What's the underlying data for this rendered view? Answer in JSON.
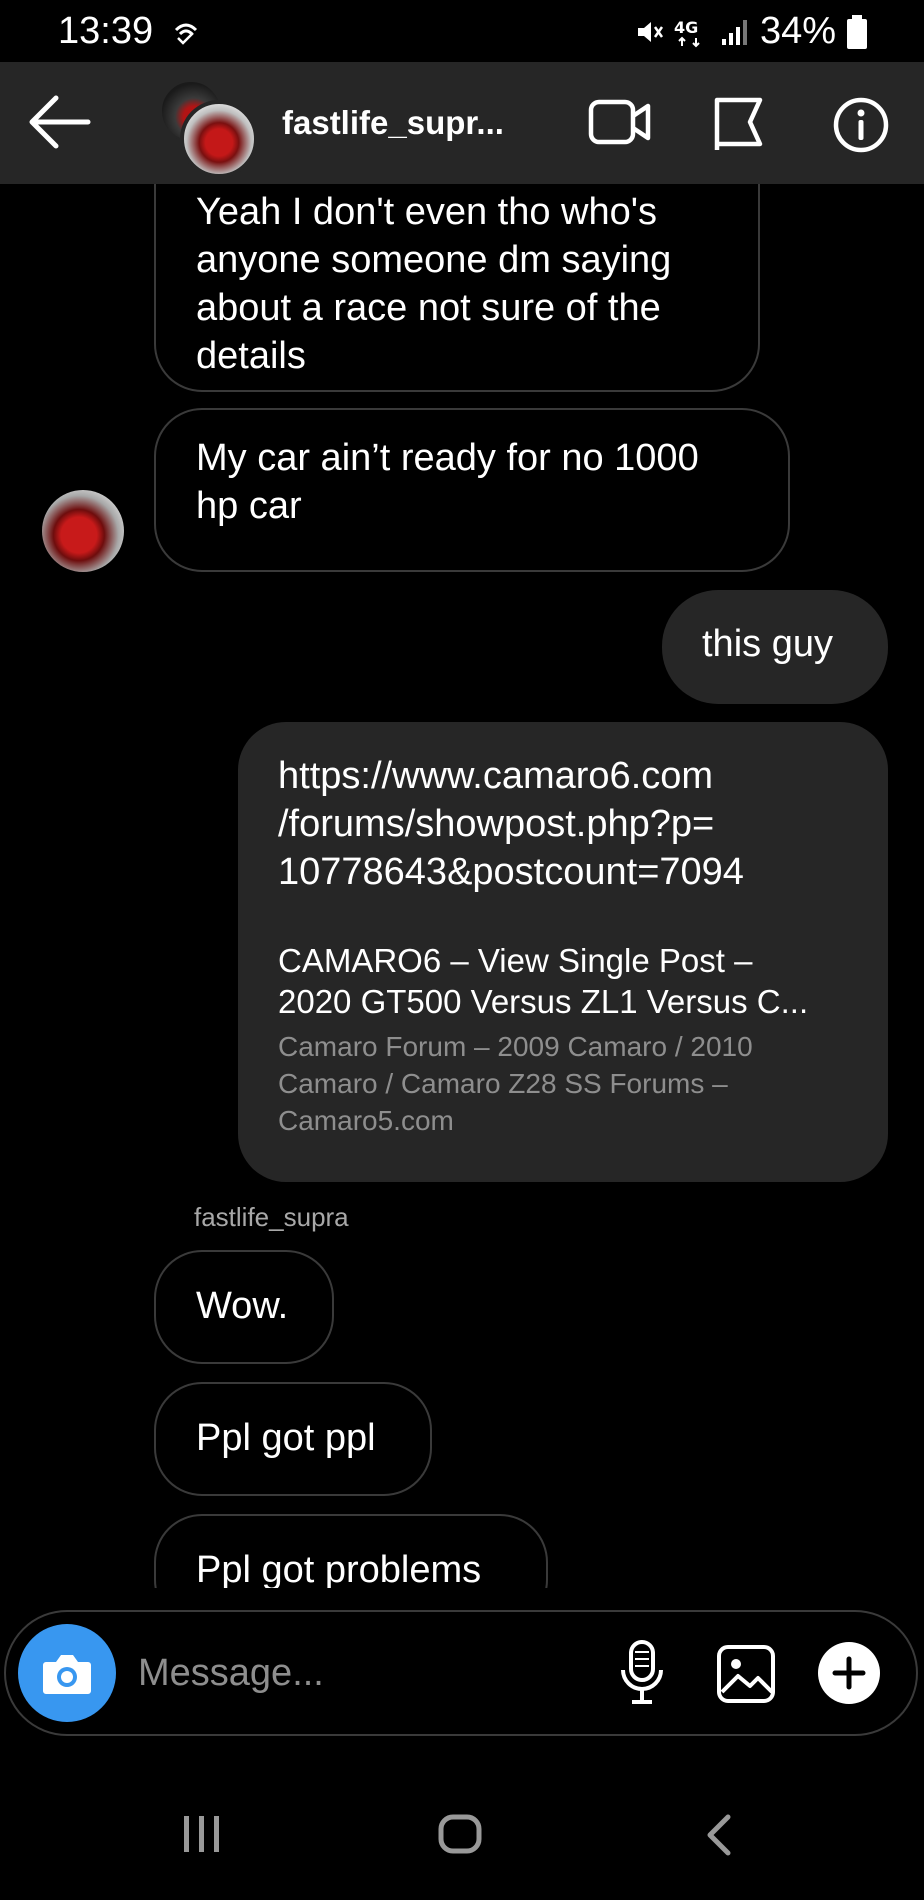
{
  "status_bar": {
    "time": "13:39",
    "battery": "34%"
  },
  "header": {
    "username": "fastlife_supr..."
  },
  "messages": [
    {
      "direction": "incoming",
      "lines": [
        "Yeah I don't even tho who's",
        "anyone someone dm saying",
        "about a race not sure of the",
        "details"
      ]
    },
    {
      "direction": "incoming",
      "lines": [
        "My car ain’t ready for no 1000",
        "hp car"
      ]
    },
    {
      "direction": "outgoing",
      "text": "this guy"
    },
    {
      "direction": "outgoing",
      "type": "link",
      "url_lines": [
        "https://www.camaro6.com",
        "/forums/showpost.php?p=",
        "10778643&postcount=7094"
      ],
      "title_lines": [
        "CAMARO6 – View Single Post –",
        "2020 GT500 Versus ZL1 Versus C..."
      ],
      "desc_lines": [
        "Camaro Forum – 2009 Camaro / 2010",
        "Camaro / Camaro Z28 SS Forums –",
        "Camaro5.com"
      ]
    },
    {
      "direction": "incoming",
      "sender": "fastlife_supra",
      "text": "Wow."
    },
    {
      "direction": "incoming",
      "text": "Ppl got ppl"
    },
    {
      "direction": "incoming",
      "text": "Ppl got problems"
    }
  ],
  "composer": {
    "placeholder": "Message..."
  },
  "colors": {
    "background": "#000000",
    "header": "#262626",
    "outgoing_bubble": "#262626",
    "incoming_border": "#3a3a3a",
    "camera_button": "#3897f0",
    "secondary_text": "#8e8e8e"
  },
  "icons": [
    "wifi-calling-icon",
    "mute-icon",
    "4g-icon",
    "signal-icon",
    "battery-icon",
    "back-arrow-icon",
    "video-call-icon",
    "flag-icon",
    "info-icon",
    "camera-icon",
    "microphone-icon",
    "gallery-icon",
    "plus-icon",
    "recents-icon",
    "home-icon",
    "nav-back-icon"
  ]
}
